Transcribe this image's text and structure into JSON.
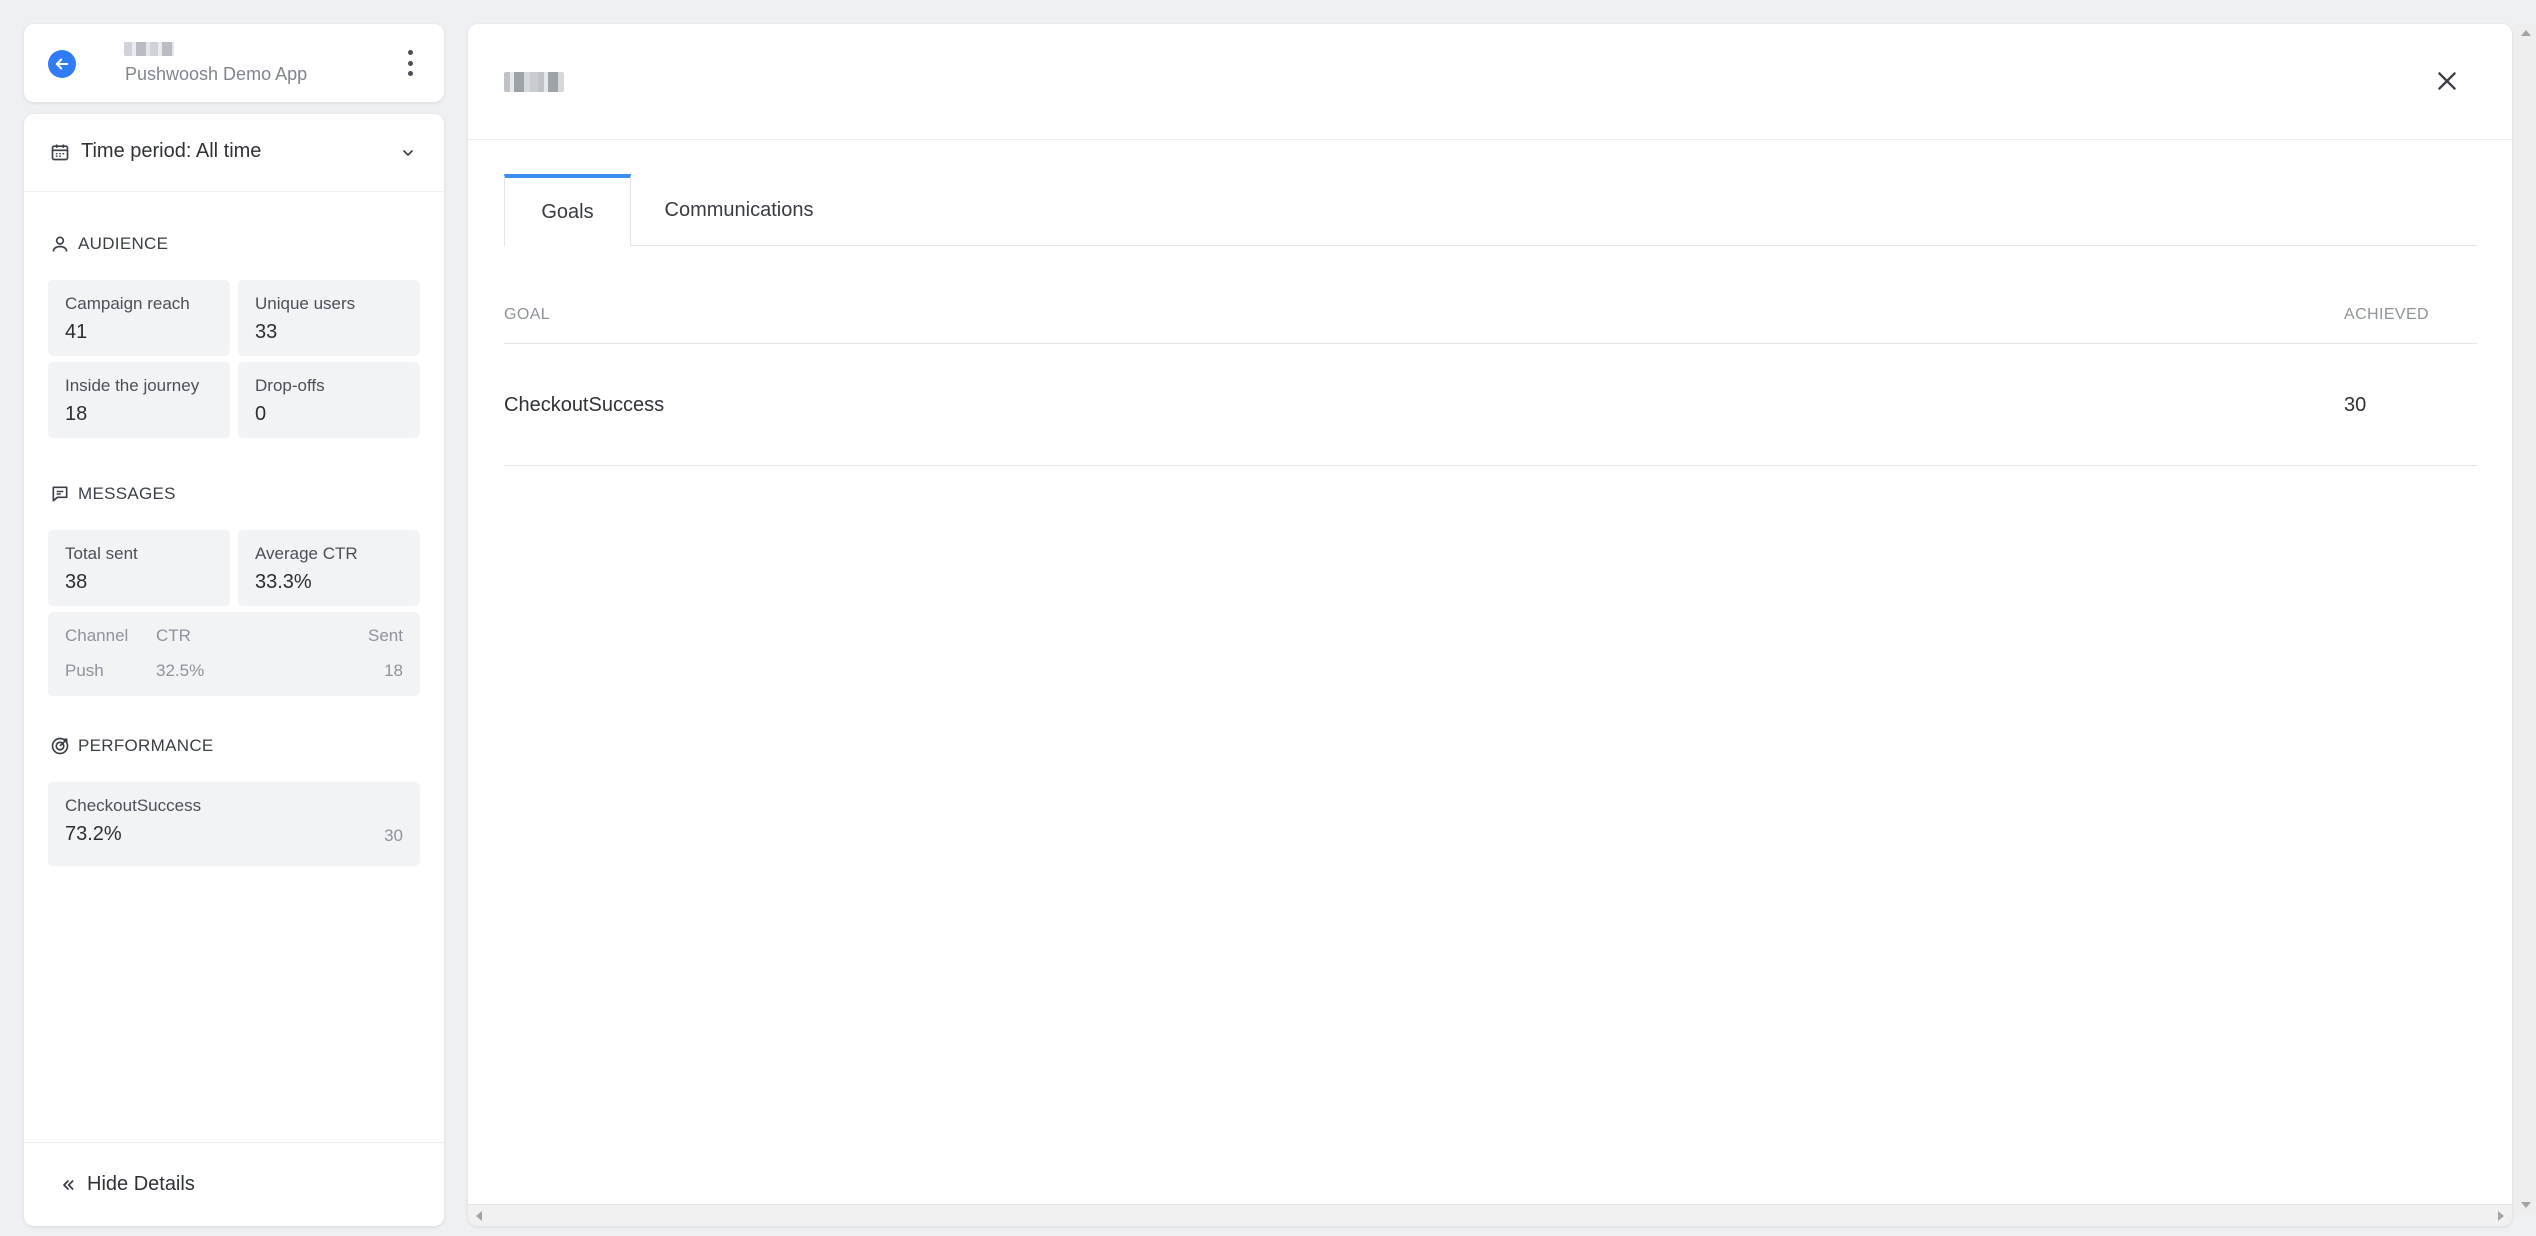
{
  "app": {
    "name": "Pushwoosh Demo App"
  },
  "details": {
    "time_period_label": "Time period: All time",
    "audience": {
      "title": "AUDIENCE",
      "stats": [
        {
          "label": "Campaign reach",
          "value": "41"
        },
        {
          "label": "Unique users",
          "value": "33"
        },
        {
          "label": "Inside the journey",
          "value": "18"
        },
        {
          "label": "Drop-offs",
          "value": "0"
        }
      ]
    },
    "messages": {
      "title": "MESSAGES",
      "stats": [
        {
          "label": "Total sent",
          "value": "38"
        },
        {
          "label": "Average CTR",
          "value": "33.3%"
        }
      ],
      "channel_table": {
        "headers": [
          "Channel",
          "CTR",
          "Sent"
        ],
        "rows": [
          [
            "Push",
            "32.5%",
            "18"
          ]
        ]
      }
    },
    "performance": {
      "title": "PERFORMANCE",
      "goals": [
        {
          "name": "CheckoutSuccess",
          "percent": "73.2%",
          "count": "30"
        }
      ]
    },
    "hide_details_label": "Hide Details"
  },
  "panel": {
    "tabs": [
      {
        "label": "Goals",
        "active": true
      },
      {
        "label": "Communications",
        "active": false
      }
    ],
    "table": {
      "headers": [
        "GOAL",
        "ACHIEVED"
      ],
      "rows": [
        [
          "CheckoutSuccess",
          "30"
        ]
      ]
    }
  },
  "colors": {
    "accent": "#2f7cf6",
    "tab_active": "#3a8ef6",
    "background": "#eef0f3",
    "stat_bg": "#f2f3f5"
  },
  "icons": {
    "back": "arrow-left-circle",
    "more": "kebab-vertical",
    "time_period": "calendar",
    "dropdown": "chevron-down",
    "audience": "user",
    "messages": "message-square",
    "performance": "target",
    "hide_details": "chevrons-left",
    "close": "x"
  }
}
